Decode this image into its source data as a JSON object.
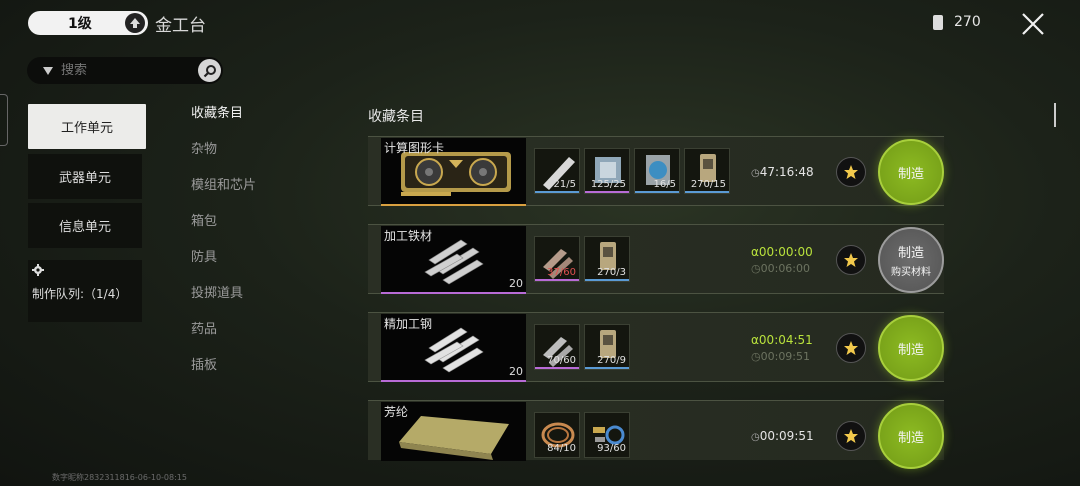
{
  "top": {
    "level": "1级",
    "station_title": "金工台",
    "currency_value": "270"
  },
  "search": {
    "placeholder": "搜索"
  },
  "categories": [
    {
      "label": "工作单元",
      "active": true
    },
    {
      "label": "武器单元",
      "active": false
    },
    {
      "label": "信息单元",
      "active": false
    }
  ],
  "queue": {
    "label": "制作队列:（1/4）"
  },
  "subcategories": [
    {
      "label": "收藏条目",
      "active": true
    },
    {
      "label": "杂物",
      "active": false
    },
    {
      "label": "模组和芯片",
      "active": false
    },
    {
      "label": "箱包",
      "active": false
    },
    {
      "label": "防具",
      "active": false
    },
    {
      "label": "投掷道具",
      "active": false
    },
    {
      "label": "药品",
      "active": false
    },
    {
      "label": "插板",
      "active": false
    }
  ],
  "section_title": "收藏条目",
  "recipes": [
    {
      "name": "计算图形卡",
      "count": "",
      "rarity_color": "#d9a040",
      "materials": [
        {
          "count": "21/5",
          "bar_color": "#5b9bd5",
          "icon": "memory-stick-icon"
        },
        {
          "count": "125/25",
          "bar_color": "#b86bd6",
          "icon": "cpu-chip-icon"
        },
        {
          "count": "16/5",
          "bar_color": "#5b9bd5",
          "icon": "cooler-fan-icon"
        },
        {
          "count": "270/15",
          "bar_color": "#5b9bd5",
          "icon": "fuel-can-icon"
        }
      ],
      "time": "47:16:48",
      "time_sub": "",
      "time_green": false,
      "craft_label": "制造",
      "craft_sub": "",
      "craft_enabled": true
    },
    {
      "name": "加工铁材",
      "count": "20",
      "rarity_color": "#b86bd6",
      "materials": [
        {
          "count": "37/60",
          "count_color": "#e05050",
          "bar_color": "#b86bd6",
          "icon": "scrap-metal-icon"
        },
        {
          "count": "270/3",
          "bar_color": "#5b9bd5",
          "icon": "fuel-can-icon"
        }
      ],
      "time": "00:00:00",
      "time_sub": "00:06:00",
      "time_green": true,
      "craft_label": "制造",
      "craft_sub": "购买材料",
      "craft_enabled": false
    },
    {
      "name": "精加工钢",
      "count": "20",
      "rarity_color": "#b86bd6",
      "materials": [
        {
          "count": "70/60",
          "bar_color": "#b86bd6",
          "icon": "steel-ingot-icon"
        },
        {
          "count": "270/9",
          "bar_color": "#5b9bd5",
          "icon": "fuel-can-icon"
        }
      ],
      "time": "00:04:51",
      "time_sub": "00:09:51",
      "time_green": true,
      "craft_label": "制造",
      "craft_sub": "",
      "craft_enabled": true
    },
    {
      "name": "芳纶",
      "count": "",
      "rarity_color": "#b86bd6",
      "materials": [
        {
          "count": "84/10",
          "bar_color": "#b86bd6",
          "icon": "copper-wire-icon"
        },
        {
          "count": "93/60",
          "bar_color": "#5b9bd5",
          "icon": "bolts-screws-icon"
        }
      ],
      "time": "00:09:51",
      "time_sub": "",
      "time_green": false,
      "craft_label": "制造",
      "craft_sub": "",
      "craft_enabled": true
    }
  ],
  "watermark": "数字昵称2832311816-06-10-08:15"
}
